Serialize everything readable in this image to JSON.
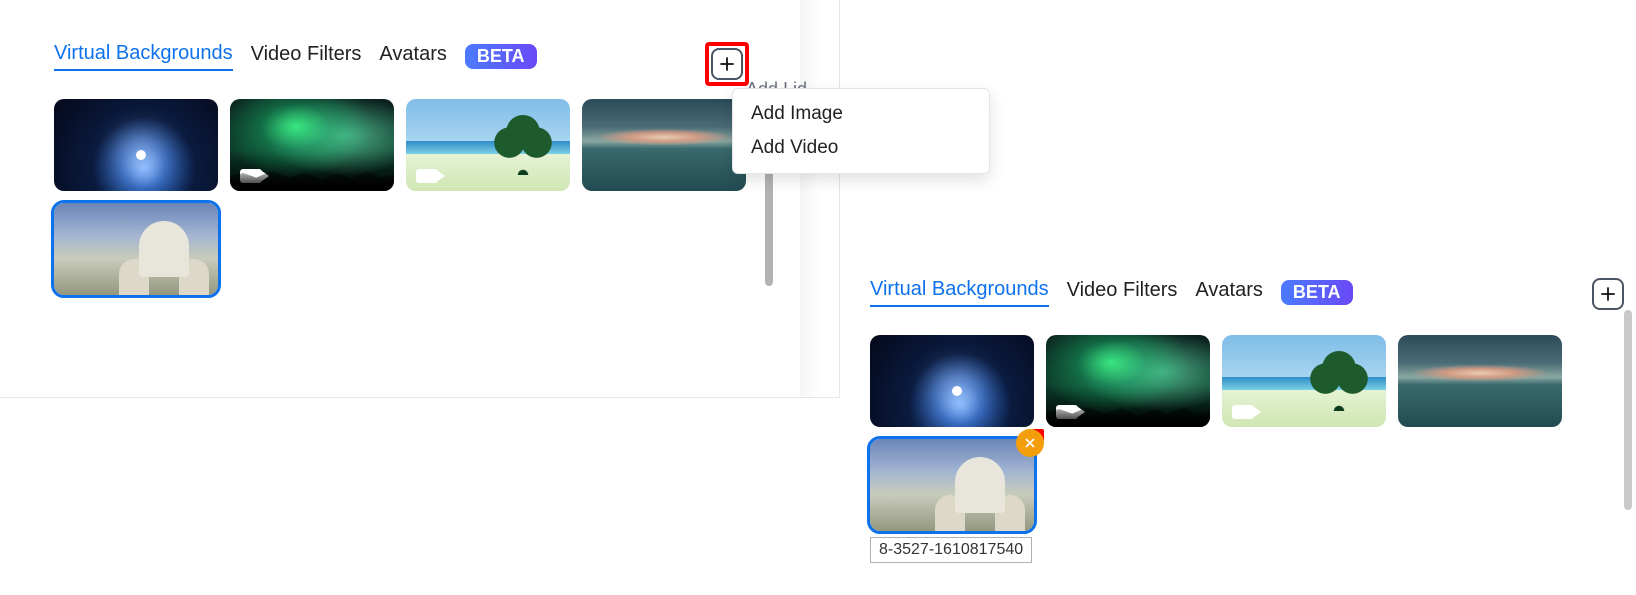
{
  "tabs": {
    "virtual_backgrounds": "Virtual Backgrounds",
    "video_filters": "Video Filters",
    "avatars": "Avatars",
    "beta_badge": "BETA"
  },
  "dropdown": {
    "peek": "Add I                  id",
    "add_image": "Add Image",
    "add_video": "Add Video"
  },
  "thumbs": [
    {
      "name": "earth",
      "video": false
    },
    {
      "name": "aurora",
      "video": true
    },
    {
      "name": "beach",
      "video": true
    },
    {
      "name": "ocean-sunset",
      "video": false
    },
    {
      "name": "capitol",
      "video": false,
      "selected": true
    }
  ],
  "right_view": {
    "selected_tooltip": "8-3527-1610817540"
  }
}
